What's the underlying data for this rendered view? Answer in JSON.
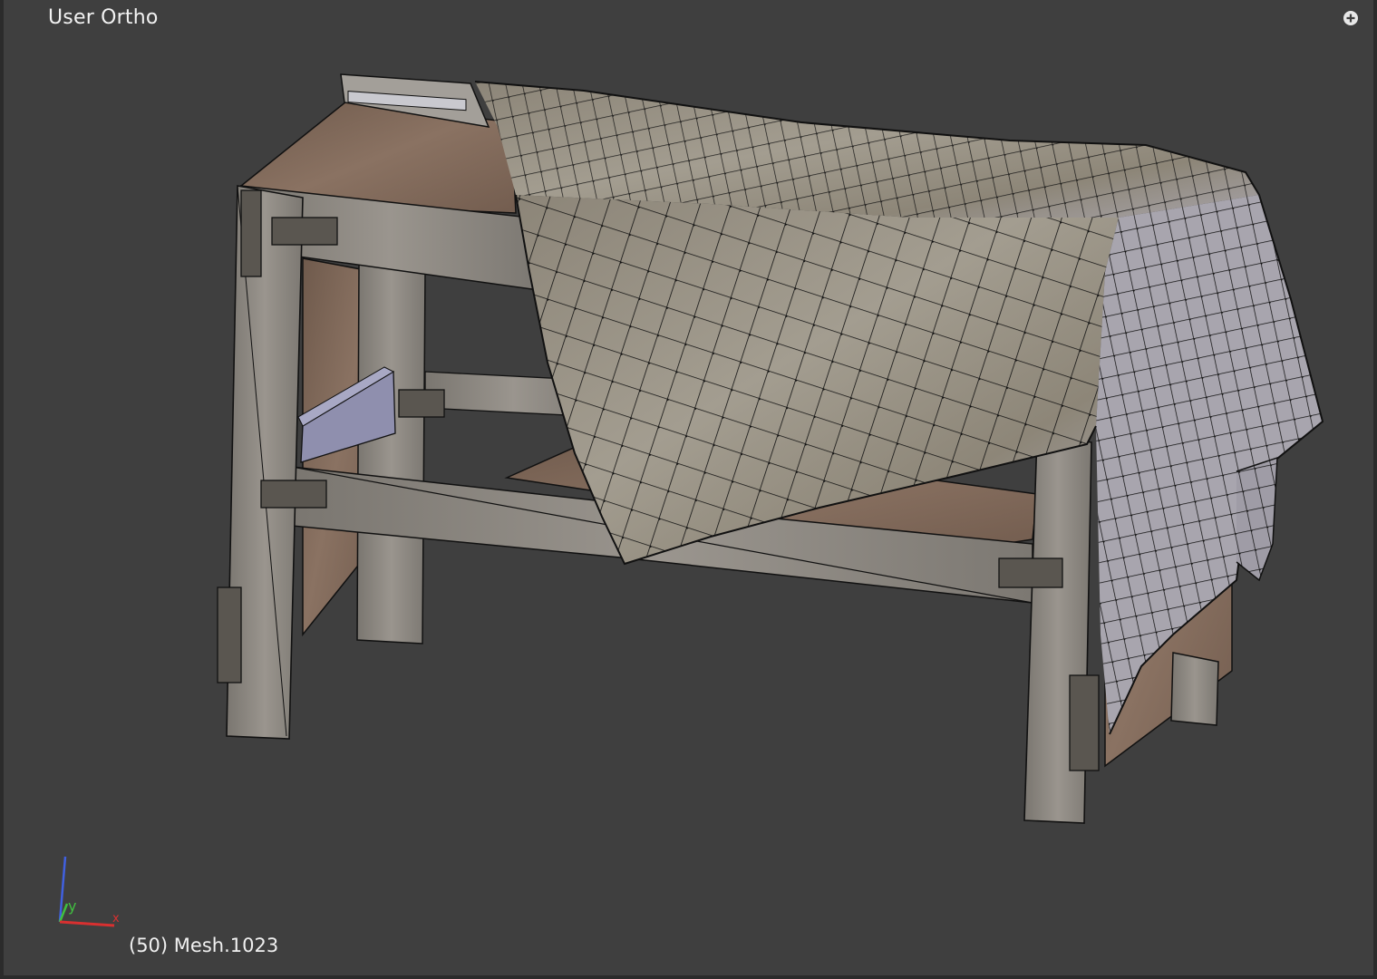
{
  "viewport": {
    "view_name": "User Ortho",
    "object_info": "(50) Mesh.1023",
    "axis_label_y": "y",
    "axis_label_x": "x"
  },
  "colors": {
    "background": "#3f3f3f",
    "wood": "#8f8a84",
    "plank_top": "#7b6658",
    "cloth": "#9a9588",
    "wire": "#111111",
    "axis_x": "#d83030",
    "axis_y": "#40c040",
    "axis_z": "#4060e0"
  },
  "icons": {
    "view_options": "plus-circle-icon"
  }
}
